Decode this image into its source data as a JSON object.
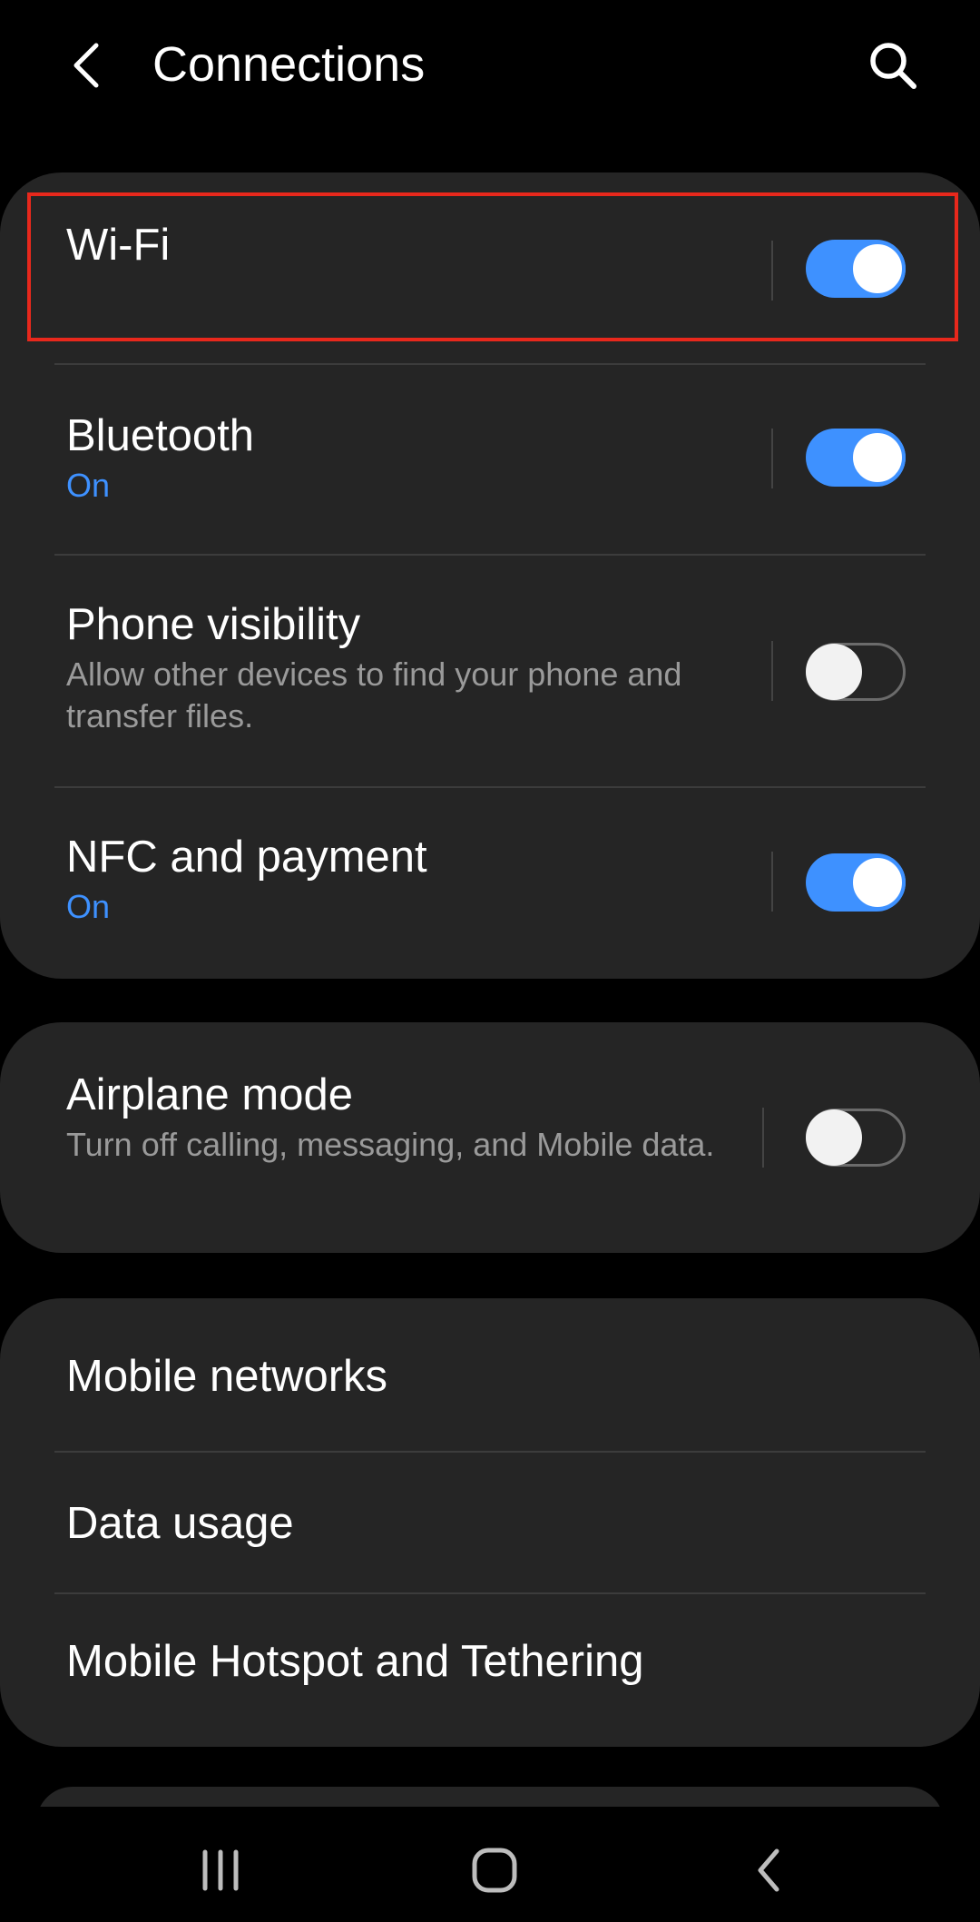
{
  "header": {
    "title": "Connections",
    "back_icon": "back-arrow-icon",
    "search_icon": "search-icon"
  },
  "connections_card": {
    "items": [
      {
        "label": "Wi-Fi",
        "status": "",
        "subtitle": "",
        "toggle_on": true
      },
      {
        "label": "Bluetooth",
        "status": "On",
        "subtitle": "",
        "toggle_on": true
      },
      {
        "label": "Phone visibility",
        "status": "",
        "subtitle": "Allow other devices to find your phone and transfer files.",
        "toggle_on": false
      },
      {
        "label": "NFC and payment",
        "status": "On",
        "subtitle": "",
        "toggle_on": true
      }
    ]
  },
  "airplane_card": {
    "label": "Airplane mode",
    "subtitle": "Turn off calling, messaging, and Mobile data.",
    "toggle_on": false
  },
  "network_card": {
    "items": [
      {
        "label": "Mobile networks"
      },
      {
        "label": "Data usage"
      },
      {
        "label": "Mobile Hotspot and Tethering"
      }
    ]
  },
  "nav_bar": {
    "recents_icon": "recents-icon",
    "home_icon": "home-icon",
    "back_icon": "nav-back-icon"
  },
  "colors": {
    "background": "#000000",
    "card": "#252525",
    "accent": "#3e91ff",
    "highlight": "#e8281c",
    "subtitle": "#9a9a9a"
  }
}
